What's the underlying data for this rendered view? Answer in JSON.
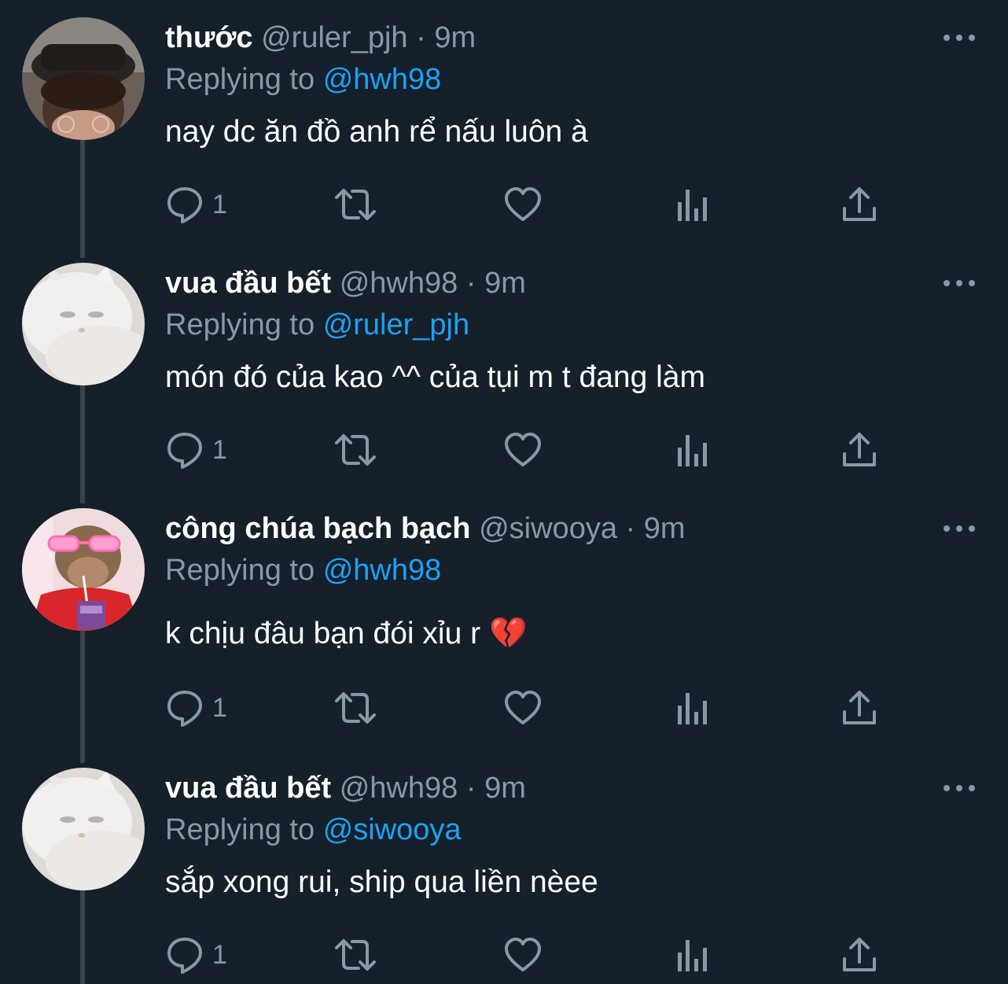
{
  "colors": {
    "background": "#15202b",
    "text_primary": "#ffffff",
    "text_secondary": "#8899a6",
    "accent": "#1da1f2",
    "thread_line": "#38444d"
  },
  "tweets": [
    {
      "name": "thước",
      "handle": "@ruler_pjh",
      "separator": "·",
      "time": "9m",
      "replying_label": "Replying to",
      "replying_to": "@hwh98",
      "text": "nay dc ăn đồ anh rể nấu luôn à",
      "reply_count": "1",
      "avatar": "avatar-person-hat"
    },
    {
      "name": "vua đầu bết",
      "handle": "@hwh98",
      "separator": "·",
      "time": "9m",
      "replying_label": "Replying to",
      "replying_to": "@ruler_pjh",
      "text": "món đó của kao ^^ của tụi m t đang làm",
      "reply_count": "1",
      "avatar": "avatar-white-cat"
    },
    {
      "name": "công chúa bạch bạch",
      "handle": "@siwooya",
      "separator": "·",
      "time": "9m",
      "replying_label": "Replying to",
      "replying_to": "@hwh98",
      "text": "k chịu đâu bạn đói xỉu r",
      "emoji": "💔",
      "reply_count": "1",
      "avatar": "avatar-monkey-sunglasses"
    },
    {
      "name": "vua đầu bết",
      "handle": "@hwh98",
      "separator": "·",
      "time": "9m",
      "replying_label": "Replying to",
      "replying_to": "@siwooya",
      "text": "sắp xong rui, ship qua liền nèee",
      "reply_count": "1",
      "avatar": "avatar-white-cat"
    }
  ],
  "icons": {
    "reply": "reply-icon",
    "retweet": "retweet-icon",
    "like": "heart-icon",
    "analytics": "analytics-icon",
    "share": "share-icon",
    "more": "more-icon"
  }
}
